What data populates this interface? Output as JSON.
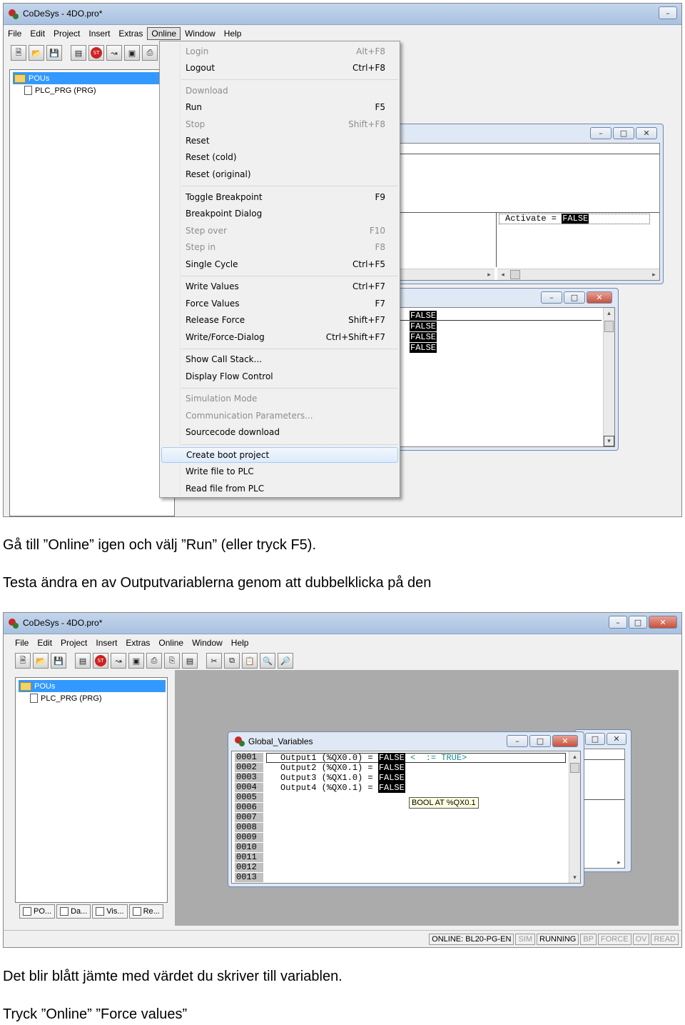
{
  "shot1": {
    "window_title": "CoDeSys - 4DO.pro*",
    "menubar": [
      "File",
      "Edit",
      "Project",
      "Insert",
      "Extras",
      "Online",
      "Window",
      "Help"
    ],
    "open_menu": "Online",
    "tree": {
      "root": "POUs",
      "child": "PLC_PRG (PRG)"
    },
    "online_menu": [
      {
        "label": "Login",
        "shortcut": "Alt+F8",
        "enabled": false
      },
      {
        "label": "Logout",
        "shortcut": "Ctrl+F8",
        "enabled": true
      },
      {
        "label": "Download",
        "shortcut": "",
        "enabled": false
      },
      {
        "label": "Run",
        "shortcut": "F5",
        "enabled": true
      },
      {
        "label": "Stop",
        "shortcut": "Shift+F8",
        "enabled": false
      },
      {
        "label": "Reset",
        "shortcut": "",
        "enabled": true
      },
      {
        "label": "Reset (cold)",
        "shortcut": "",
        "enabled": true
      },
      {
        "label": "Reset (original)",
        "shortcut": "",
        "enabled": true
      },
      {
        "label": "Toggle Breakpoint",
        "shortcut": "F9",
        "enabled": true
      },
      {
        "label": "Breakpoint Dialog",
        "shortcut": "",
        "enabled": true
      },
      {
        "label": "Step over",
        "shortcut": "F10",
        "enabled": false
      },
      {
        "label": "Step in",
        "shortcut": "F8",
        "enabled": false
      },
      {
        "label": "Single Cycle",
        "shortcut": "Ctrl+F5",
        "enabled": true
      },
      {
        "label": "Write Values",
        "shortcut": "Ctrl+F7",
        "enabled": true
      },
      {
        "label": "Force Values",
        "shortcut": "F7",
        "enabled": true
      },
      {
        "label": "Release Force",
        "shortcut": "Shift+F7",
        "enabled": true
      },
      {
        "label": "Write/Force-Dialog",
        "shortcut": "Ctrl+Shift+F7",
        "enabled": true
      },
      {
        "label": "Show Call Stack...",
        "shortcut": "",
        "enabled": true
      },
      {
        "label": "Display Flow Control",
        "shortcut": "",
        "enabled": true
      },
      {
        "label": "Simulation Mode",
        "shortcut": "",
        "enabled": false
      },
      {
        "label": "Communication Parameters...",
        "shortcut": "",
        "enabled": false
      },
      {
        "label": "Sourcecode download",
        "shortcut": "",
        "enabled": true
      },
      {
        "label": "Create boot project",
        "shortcut": "",
        "enabled": true
      },
      {
        "label": "Write file to PLC",
        "shortcut": "",
        "enabled": true
      },
      {
        "label": "Read file from PLC",
        "shortcut": "",
        "enabled": true
      }
    ],
    "highlighted_item": "Create boot project",
    "prg_window": {
      "expr": "Activate = ",
      "value": "FALSE"
    },
    "vars_window": {
      "values": [
        "FALSE",
        "FALSE",
        "FALSE",
        "FALSE"
      ]
    }
  },
  "text1": "Gå till ”Online” igen och välj ”Run” (eller tryck F5).",
  "text2": "Testa ändra en av Outputvariablerna genom att dubbelklicka på den",
  "shot2": {
    "window_title": "CoDeSys - 4DO.pro*",
    "menubar": [
      "File",
      "Edit",
      "Project",
      "Insert",
      "Extras",
      "Online",
      "Window",
      "Help"
    ],
    "tree": {
      "root": "POUs",
      "child": "PLC_PRG (PRG)"
    },
    "bottom_tabs": [
      "PO...",
      "Da...",
      "Vis...",
      "Re..."
    ],
    "global_vars": {
      "title": "Global_Variables",
      "line_numbers": [
        "0001",
        "0002",
        "0003",
        "0004",
        "0005",
        "0006",
        "0007",
        "0008",
        "0009",
        "0010",
        "0011",
        "0012",
        "0013"
      ],
      "rows": [
        {
          "text": "Output1 (%QX0.0) = ",
          "value": "FALSE",
          "pending": " <  := TRUE>"
        },
        {
          "text": "Output2 (%QX0.1) = ",
          "value": "FALSE",
          "pending": ""
        },
        {
          "text": "Output3 (%QX1.0) = ",
          "value": "FALSE",
          "pending": ""
        },
        {
          "text": "Output4 (%QX0.1) = ",
          "value": "FALSE",
          "pending": ""
        }
      ],
      "tooltip": "BOOL AT %QX0.1"
    },
    "status": [
      {
        "text": "ONLINE: BL20-PG-EN",
        "active": true
      },
      {
        "text": "SIM",
        "active": false
      },
      {
        "text": "RUNNING",
        "active": true
      },
      {
        "text": "BP",
        "active": false
      },
      {
        "text": "FORCE",
        "active": false
      },
      {
        "text": "OV",
        "active": false
      },
      {
        "text": "READ",
        "active": false
      }
    ]
  },
  "text3": "Det blir blått jämte med värdet du skriver till variablen.",
  "text4": "Tryck ”Online” ”Force values”"
}
